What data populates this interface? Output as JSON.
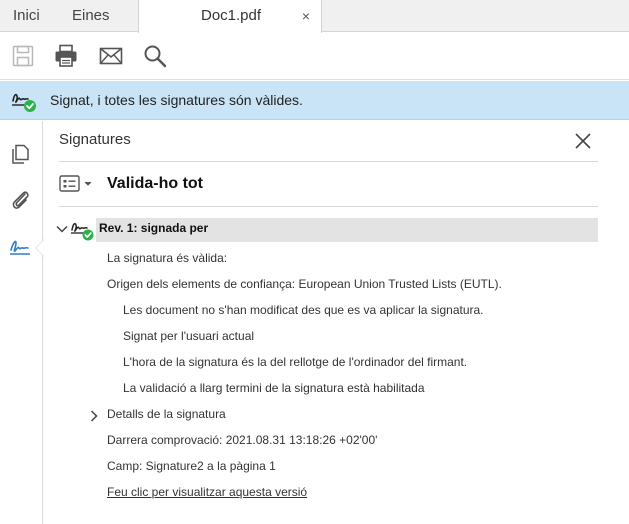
{
  "tabs": {
    "home": "Inici",
    "tools": "Eines",
    "document": "Doc1.pdf",
    "close_glyph": "×"
  },
  "toolbar": {
    "icons": [
      "save-icon",
      "print-icon",
      "mail-icon",
      "search-icon"
    ]
  },
  "infobar": {
    "text": "Signat, i totes les signatures són vàlides.",
    "accent": "#c9e4f6",
    "status_color": "#2bb34a"
  },
  "sidebar": {
    "icons": [
      "pages-icon",
      "attachment-icon",
      "signature-icon"
    ],
    "active_color": "#2f7fc7"
  },
  "panel": {
    "title": "Signatures",
    "validate_all": "Valida-ho tot",
    "revision": {
      "label": "Rev. 1: signada per",
      "lines": [
        "La signatura és vàlida:",
        "Origen dels elements de confiança: European Union Trusted Lists (EUTL).",
        "Les document no s'han modificat des que es va aplicar la signatura.",
        "Signat per l'usuari actual",
        "L'hora de la signatura és la del rellotge de l'ordinador del firmant.",
        "La validació a llarg termini de la signatura està habilitada"
      ],
      "details": "Detalls de la signatura",
      "last_check": "Darrera comprovació: 2021.08.31 13:18:26 +02'00'",
      "field": "Camp: Signature2 a la pàgina 1",
      "view_link": "Feu clic per visualitzar aquesta versió"
    }
  }
}
